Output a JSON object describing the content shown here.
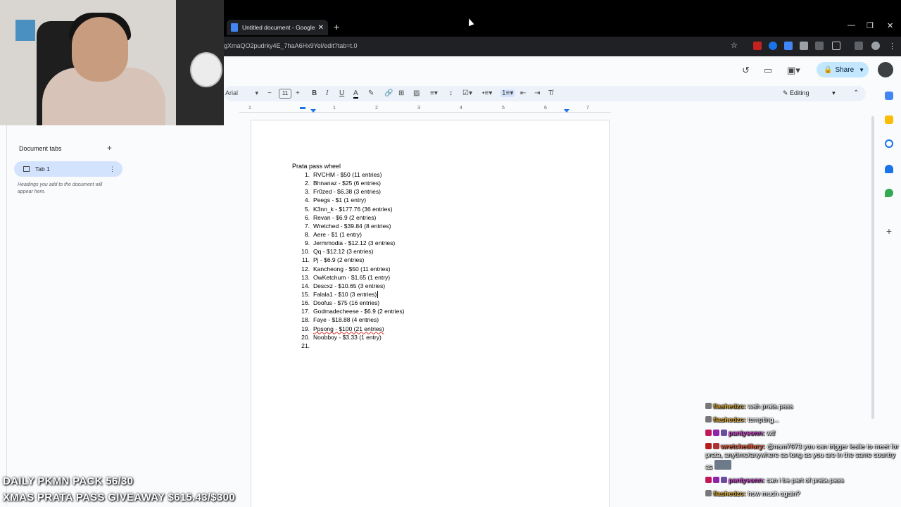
{
  "browser": {
    "tab_title": "Untitled document - Google Do",
    "url": "gXmaQO2pudrky4E_7haA6Hx9Yel/edit?tab=t.0"
  },
  "docs_header": {
    "share_label": "Share"
  },
  "toolbar": {
    "font": "Arial",
    "font_size": "11",
    "mode": "Editing"
  },
  "ruler": {
    "ticks": [
      "1",
      "1",
      "2",
      "3",
      "4",
      "5",
      "6",
      "7"
    ]
  },
  "sidebar": {
    "title": "Document tabs",
    "tab_label": "Tab 1",
    "hint": "Headings you add to the document will appear here."
  },
  "document": {
    "title": "Prata pass wheel",
    "entries": [
      {
        "num": "1.",
        "text": "RVCHM - $50 (11 entries)"
      },
      {
        "num": "2.",
        "text": "Bhnanaz - $25 (6 entries)"
      },
      {
        "num": "3.",
        "text": "Fr0zed - $6.38 (3 entries)"
      },
      {
        "num": "4.",
        "text": "Peegs - $1 (1 entry)"
      },
      {
        "num": "5.",
        "text": "K3nn_k - $177.76 (36 entries)"
      },
      {
        "num": "6.",
        "text": "Revan - $6.9 (2 entries)"
      },
      {
        "num": "7.",
        "text": "Wretched - $39.84 (8 entries)"
      },
      {
        "num": "8.",
        "text": "Aere - $1 (1 entry)"
      },
      {
        "num": "9.",
        "text": "Jermmodia - $12.12 (3 entries)"
      },
      {
        "num": "10.",
        "text": "Qq - $12.12 (3 entries)"
      },
      {
        "num": "11.",
        "text": "Pj - $6.9 (2 entries)"
      },
      {
        "num": "12.",
        "text": "Kancheong - $50 (11 entries)"
      },
      {
        "num": "13.",
        "text": "OwKetchum - $1.65 (1 entry)"
      },
      {
        "num": "14.",
        "text": "Descxz - $10.65 (3 entries)"
      },
      {
        "num": "15.",
        "text": "Falala1 - $10 (3 entries)"
      },
      {
        "num": "16.",
        "text": "Doofus - $75 (16 entries)"
      },
      {
        "num": "17.",
        "text": "Godmadecheese - $6.9 (2 entries)"
      },
      {
        "num": "18.",
        "text": "Faye - $18.88 (4 entries)"
      },
      {
        "num": "19.",
        "text": "Ppsong - $100 (21 entries)"
      },
      {
        "num": "20.",
        "text": "Noobboy - $3.33 (1 entry)"
      },
      {
        "num": "21.",
        "text": ""
      }
    ]
  },
  "chat": [
    {
      "user": "flashedzc:",
      "text": "wah prata pass",
      "style": "u-flash"
    },
    {
      "user": "flashedzc:",
      "text": "tempting...",
      "style": "u-flash"
    },
    {
      "user": "pantyeonn:",
      "text": "wtf",
      "style": "u-panty"
    },
    {
      "user": "wretchedfury:",
      "text": "@nam7673 you can trigger leslie to meet for prata, anytime/anywhere as long as you are in the same country as",
      "style": "u-wretch"
    },
    {
      "user": "pantyeonn:",
      "text": "can i be part of prata pass",
      "style": "u-panty"
    },
    {
      "user": "flashedzc:",
      "text": "how much again?",
      "style": "u-flash"
    }
  ],
  "overlay": {
    "line1": "DAILY PKMN PACK 56/30",
    "line2": "XMAS PRATA PASS GIVEAWAY $615.43/$300"
  },
  "colors": {
    "share_bg": "#c2e7ff",
    "tab_selected_bg": "#d3e3fd",
    "chrome_bg": "#000000"
  }
}
